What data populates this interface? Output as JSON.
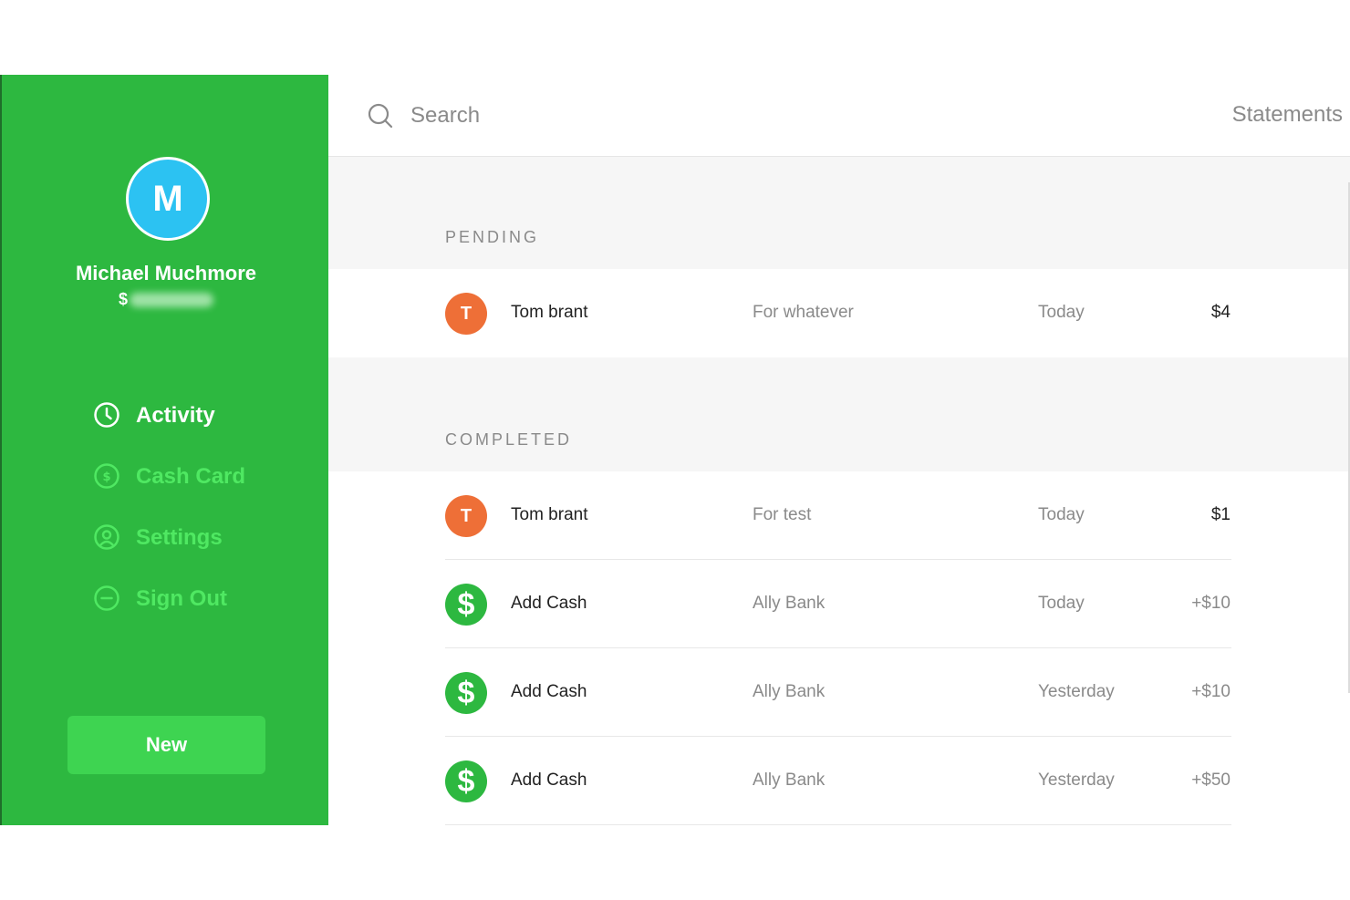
{
  "sidebar": {
    "avatar_initial": "M",
    "user_name": "Michael Muchmore",
    "cashtag_prefix": "$",
    "nav": [
      {
        "label": "Activity",
        "icon": "clock-icon",
        "active": true
      },
      {
        "label": "Cash Card",
        "icon": "dollar-circle-icon",
        "active": false
      },
      {
        "label": "Settings",
        "icon": "user-circle-icon",
        "active": false
      },
      {
        "label": "Sign Out",
        "icon": "minus-circle-icon",
        "active": false
      }
    ],
    "new_button": "New"
  },
  "header": {
    "search_placeholder": "Search",
    "statements_link": "Statements"
  },
  "pending": {
    "title": "PENDING",
    "rows": [
      {
        "avatar": "T",
        "name": "Tom brant",
        "note": "For whatever",
        "date": "Today",
        "amount": "$4"
      }
    ]
  },
  "completed": {
    "title": "COMPLETED",
    "rows": [
      {
        "avatar": "T",
        "name": "Tom brant",
        "note": "For test",
        "date": "Today",
        "amount": "$1"
      },
      {
        "avatar": "$",
        "name": "Add Cash",
        "note": "Ally Bank",
        "date": "Today",
        "amount": "+$10"
      },
      {
        "avatar": "$",
        "name": "Add Cash",
        "note": "Ally Bank",
        "date": "Yesterday",
        "amount": "+$10"
      },
      {
        "avatar": "$",
        "name": "Add Cash",
        "note": "Ally Bank",
        "date": "Yesterday",
        "amount": "+$50"
      }
    ]
  },
  "colors": {
    "sidebar_green": "#2db840",
    "inactive_nav": "#4fe862",
    "avatar_blue": "#2cc2f2",
    "avatar_orange": "#ee6f37"
  }
}
